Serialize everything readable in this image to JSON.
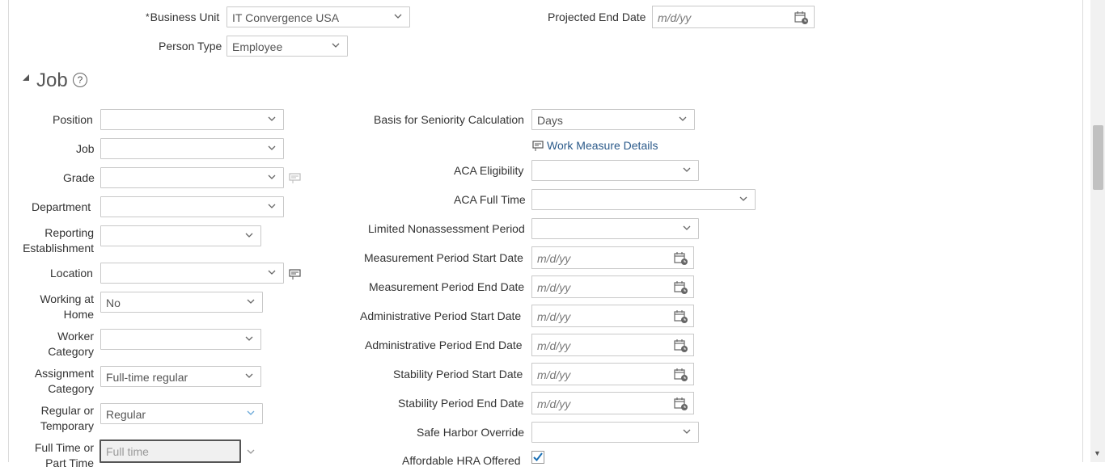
{
  "top": {
    "business_unit_label": "Business Unit",
    "business_unit_value": "IT Convergence USA",
    "required_mark": "*",
    "projected_end_label": "Projected End Date",
    "projected_end_placeholder": "m/d/yy",
    "person_type_label": "Person Type",
    "person_type_value": "Employee"
  },
  "section": {
    "title": "Job",
    "help": "?"
  },
  "left": {
    "position_label": "Position",
    "job_label": "Job",
    "grade_label": "Grade",
    "department_label": "Department",
    "reporting_est_label": "Reporting Establishment",
    "location_label": "Location",
    "working_home_label": "Working at Home",
    "working_home_value": "No",
    "worker_cat_label": "Worker Category",
    "assign_cat_label": "Assignment Category",
    "assign_cat_value": "Full-time regular",
    "reg_temp_label": "Regular or Temporary",
    "reg_temp_value": "Regular",
    "ft_pt_label": "Full Time or Part Time",
    "ft_pt_value": "Full time"
  },
  "right": {
    "seniority_label": "Basis for Seniority Calculation",
    "seniority_value": "Days",
    "work_measure_link": "Work Measure Details",
    "aca_elig_label": "ACA Eligibility",
    "aca_ft_label": "ACA Full Time",
    "limited_label": "Limited Nonassessment Period",
    "meas_start_label": "Measurement Period Start Date",
    "meas_end_label": "Measurement Period End Date",
    "admin_start_label": "Administrative Period Start Date",
    "admin_end_label": "Administrative Period End Date",
    "stab_start_label": "Stability Period Start Date",
    "stab_end_label": "Stability Period End Date",
    "safe_harbor_label": "Safe Harbor Override",
    "hra_label": "Affordable HRA Offered",
    "date_placeholder": "m/d/yy"
  },
  "icons": {
    "dropdown": "chevron-down-icon",
    "calendar": "calendar-icon",
    "details": "details-icon",
    "check": "checkmark-icon"
  },
  "colors": {
    "link": "#2b5a8a",
    "checkbox": "#1a6fb5"
  }
}
